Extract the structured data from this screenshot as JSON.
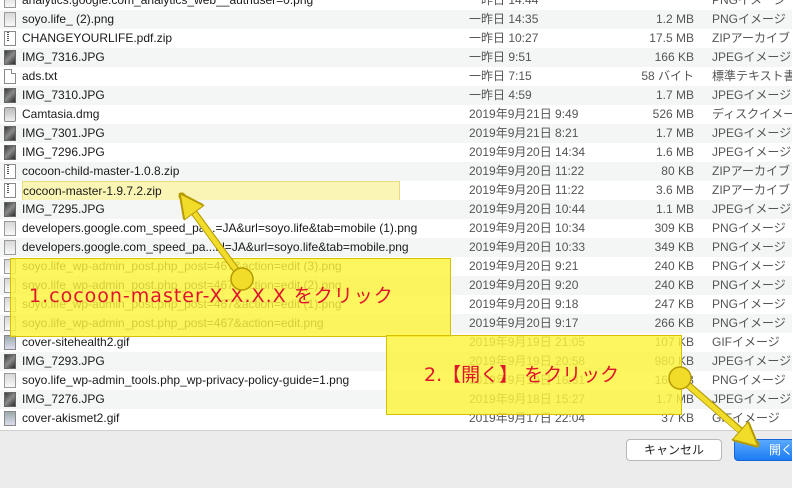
{
  "files": [
    {
      "icon": "png",
      "name": "analytics.google.com_analytics_web__authuser=0.png",
      "date": "一昨日 14:44",
      "size": "",
      "kind": "PNGイメージ"
    },
    {
      "icon": "png",
      "name": "soyo.life_ (2).png",
      "date": "一昨日 14:35",
      "size": "1.2 MB",
      "kind": "PNGイメージ"
    },
    {
      "icon": "zip",
      "name": "CHANGEYOURLIFE.pdf.zip",
      "date": "一昨日 10:27",
      "size": "17.5 MB",
      "kind": "ZIPアーカイブ"
    },
    {
      "icon": "img",
      "name": "IMG_7316.JPG",
      "date": "一昨日 9:51",
      "size": "166 KB",
      "kind": "JPEGイメージ"
    },
    {
      "icon": "doc",
      "name": "ads.txt",
      "date": "一昨日 7:15",
      "size": "58 バイト",
      "kind": "標準テキスト書"
    },
    {
      "icon": "img",
      "name": "IMG_7310.JPG",
      "date": "一昨日 4:59",
      "size": "1.7 MB",
      "kind": "JPEGイメージ"
    },
    {
      "icon": "dmg",
      "name": "Camtasia.dmg",
      "date": "2019年9月21日 9:49",
      "size": "526 MB",
      "kind": "ディスクイメー"
    },
    {
      "icon": "img",
      "name": "IMG_7301.JPG",
      "date": "2019年9月21日 8:21",
      "size": "1.7 MB",
      "kind": "JPEGイメージ"
    },
    {
      "icon": "img",
      "name": "IMG_7296.JPG",
      "date": "2019年9月20日 14:34",
      "size": "1.6 MB",
      "kind": "JPEGイメージ"
    },
    {
      "icon": "zip",
      "name": "cocoon-child-master-1.0.8.zip",
      "date": "2019年9月20日 11:22",
      "size": "80 KB",
      "kind": "ZIPアーカイブ"
    },
    {
      "icon": "zip",
      "name": "cocoon-master-1.9.7.2.zip",
      "date": "2019年9月20日 11:22",
      "size": "3.6 MB",
      "kind": "ZIPアーカイブ",
      "selected": true
    },
    {
      "icon": "img",
      "name": "IMG_7295.JPG",
      "date": "2019年9月20日 10:44",
      "size": "1.1 MB",
      "kind": "JPEGイメージ"
    },
    {
      "icon": "png",
      "name": "developers.google.com_speed_pa...=JA&url=soyo.life&tab=mobile (1).png",
      "date": "2019年9月20日 10:34",
      "size": "309 KB",
      "kind": "PNGイメージ"
    },
    {
      "icon": "png",
      "name": "developers.google.com_speed_pa...hl=JA&url=soyo.life&tab=mobile.png",
      "date": "2019年9月20日 10:33",
      "size": "349 KB",
      "kind": "PNGイメージ"
    },
    {
      "icon": "png",
      "name": "soyo.life_wp-admin_post.php_post=467&action=edit (3).png",
      "date": "2019年9月20日 9:21",
      "size": "240 KB",
      "kind": "PNGイメージ"
    },
    {
      "icon": "png",
      "name": "soyo.life_wp-admin_post.php_post=467&action=edit (2).png",
      "date": "2019年9月20日 9:20",
      "size": "240 KB",
      "kind": "PNGイメージ"
    },
    {
      "icon": "png",
      "name": "soyo.life_wp-admin_post.php_post=467&action=edit (1).png",
      "date": "2019年9月20日 9:18",
      "size": "247 KB",
      "kind": "PNGイメージ"
    },
    {
      "icon": "png",
      "name": "soyo.life_wp-admin_post.php_post=467&action=edit.png",
      "date": "2019年9月20日 9:17",
      "size": "266 KB",
      "kind": "PNGイメージ"
    },
    {
      "icon": "gif",
      "name": "cover-sitehealth2.gif",
      "date": "2019年9月19日 21:05",
      "size": "107 KB",
      "kind": "GIFイメージ"
    },
    {
      "icon": "img",
      "name": "IMG_7293.JPG",
      "date": "2019年9月19日 20:58",
      "size": "980 KB",
      "kind": "JPEGイメージ"
    },
    {
      "icon": "png",
      "name": "soyo.life_wp-admin_tools.php_wp-privacy-policy-guide=1.png",
      "date": "2019年9月19日 16:31",
      "size": "166 KB",
      "kind": "PNGイメージ"
    },
    {
      "icon": "img",
      "name": "IMG_7276.JPG",
      "date": "2019年9月18日 15:27",
      "size": "1.7 MB",
      "kind": "JPEGイメージ"
    },
    {
      "icon": "gif",
      "name": "cover-akismet2.gif",
      "date": "2019年9月17日 22:04",
      "size": "37 KB",
      "kind": "GIFイメージ"
    }
  ],
  "buttons": {
    "cancel_label": "キャンセル",
    "open_label": "開く"
  },
  "callouts": {
    "step1": "1.cocoon-master-X.X.X.X をクリック",
    "step2": "2.【開く】 をクリック"
  },
  "colors": {
    "callout_fill": "#fcf43c",
    "callout_text": "#e0142c",
    "arrow": "#f2dc2a",
    "selection": "#faf5b4",
    "primary_button": "#1c7cf3"
  }
}
